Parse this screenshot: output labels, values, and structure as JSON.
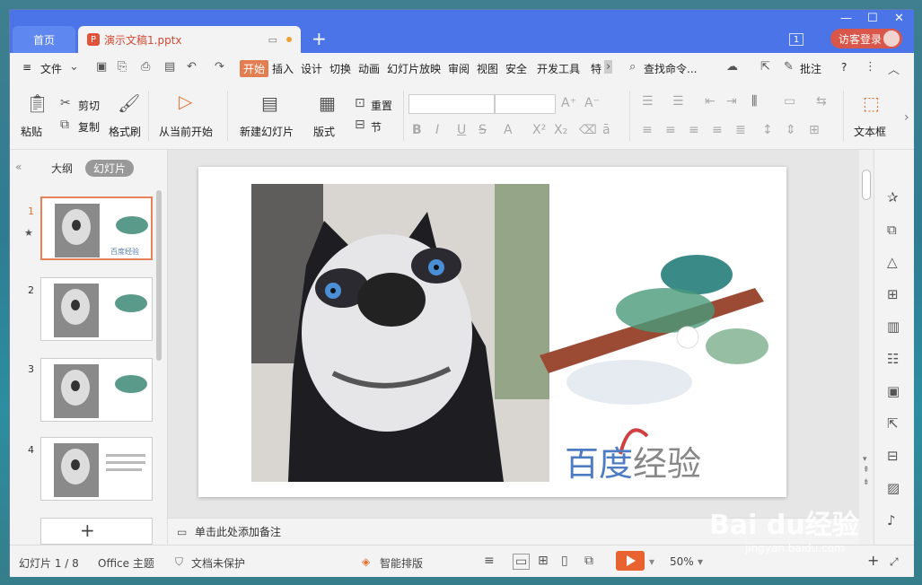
{
  "tabs": {
    "home": "首页",
    "document": "演示文稿1.pptx",
    "add": "+",
    "badge": "1",
    "login": "访客登录"
  },
  "window_controls": {
    "minimize": "—",
    "maximize": "☐",
    "close": "✕"
  },
  "menu": {
    "hamburger": "≡",
    "file": "文件",
    "items": [
      "开始",
      "插入",
      "设计",
      "切换",
      "动画",
      "幻灯片放映",
      "审阅",
      "视图",
      "安全",
      "开发工具",
      "特"
    ],
    "search": "查找命令...",
    "annotate": "批注",
    "help": "?"
  },
  "ribbon": {
    "paste": "粘贴",
    "cut": "剪切",
    "copy": "复制",
    "format_painter": "格式刷",
    "from_current": "从当前开始",
    "new_slide": "新建幻灯片",
    "layout": "版式",
    "reset": "重置",
    "section": "节",
    "textbox": "文本框"
  },
  "left_panel": {
    "outline_tab": "大纲",
    "slides_tab": "幻灯片",
    "slides": [
      "1",
      "2",
      "3",
      "4"
    ],
    "add": "+"
  },
  "slide": {
    "title_blue": "百度",
    "title_gray": "经验"
  },
  "notes": {
    "placeholder": "单击此处添加备注"
  },
  "status": {
    "slide_count": "幻灯片 1 / 8",
    "theme": "Office 主题",
    "protection": "文档未保护",
    "smart_layout": "智能排版",
    "zoom": "50%"
  },
  "watermark": {
    "logo": "Bai du经验",
    "url": "jingyan.baidu.com"
  },
  "colors": {
    "titlebar": "#4a74e8",
    "accent": "#e37e52",
    "play": "#e8632f"
  }
}
